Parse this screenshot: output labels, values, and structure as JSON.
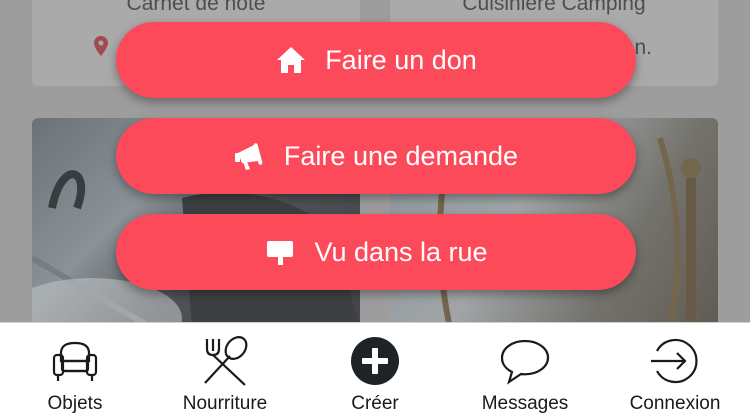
{
  "feed": {
    "card_top_left": {
      "title": "Carnet de note"
    },
    "card_top_right": {
      "title": "Cuisinière Camping",
      "meta": "n."
    }
  },
  "actions": [
    {
      "label": "Faire un don",
      "icon": "home-icon"
    },
    {
      "label": "Faire une demande",
      "icon": "megaphone-icon"
    },
    {
      "label": "Vu dans la rue",
      "icon": "speech-sign-icon"
    }
  ],
  "tabbar": {
    "items": [
      {
        "label": "Objets",
        "icon": "armchair-icon"
      },
      {
        "label": "Nourriture",
        "icon": "fork-spoon-icon"
      },
      {
        "label": "Créer",
        "icon": "plus-circle-icon"
      },
      {
        "label": "Messages",
        "icon": "chat-bubble-icon"
      },
      {
        "label": "Connexion",
        "icon": "login-arrow-icon"
      }
    ]
  },
  "colors": {
    "accent": "#fd4a5a",
    "tab_text": "#1a1a1a",
    "pin": "#c0393f"
  }
}
